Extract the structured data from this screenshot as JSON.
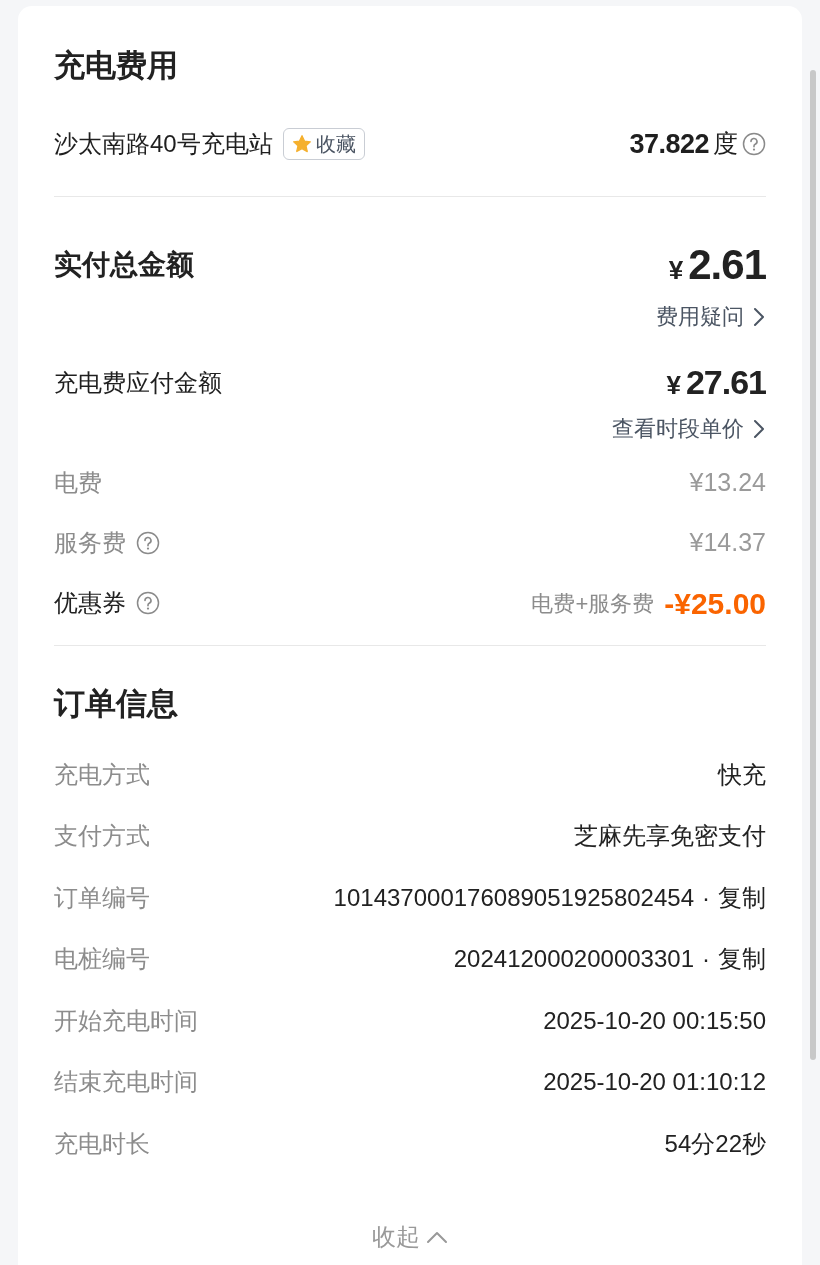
{
  "fee_section": {
    "title": "充电费用",
    "station": "沙太南路40号充电站",
    "favorite": {
      "label": "收藏",
      "selected": true
    },
    "energy": {
      "value": "37.822",
      "unit": "度",
      "help_icon": true
    },
    "total": {
      "label": "实付总金额",
      "currency": "¥",
      "amount": "2.61",
      "link": "费用疑问"
    },
    "payable": {
      "label": "充电费应付金额",
      "currency": "¥",
      "amount": "27.61",
      "link": "查看时段单价"
    },
    "items": [
      {
        "label": "电费",
        "help_icon": false,
        "amount": "¥13.24",
        "kind": "plain"
      },
      {
        "label": "服务费",
        "help_icon": true,
        "amount": "¥14.37",
        "kind": "plain"
      },
      {
        "label": "优惠券",
        "help_icon": true,
        "note": "电费+服务费",
        "amount": "-¥25.00",
        "kind": "discount"
      }
    ]
  },
  "order_section": {
    "title": "订单信息",
    "rows": [
      {
        "label": "充电方式",
        "value": "快充"
      },
      {
        "label": "支付方式",
        "value": "芝麻先享免密支付"
      },
      {
        "label": "订单编号",
        "value": "101437000176089051925802454",
        "separator": "·",
        "action": "复制"
      },
      {
        "label": "电桩编号",
        "value": "202412000200003301",
        "separator": "·",
        "action": "复制"
      },
      {
        "label": "开始充电时间",
        "value": "2025-10-20 00:15:50"
      },
      {
        "label": "结束充电时间",
        "value": "2025-10-20 01:10:12"
      },
      {
        "label": "充电时长",
        "value": "54分22秒"
      }
    ]
  },
  "collapse": {
    "label": "收起"
  }
}
